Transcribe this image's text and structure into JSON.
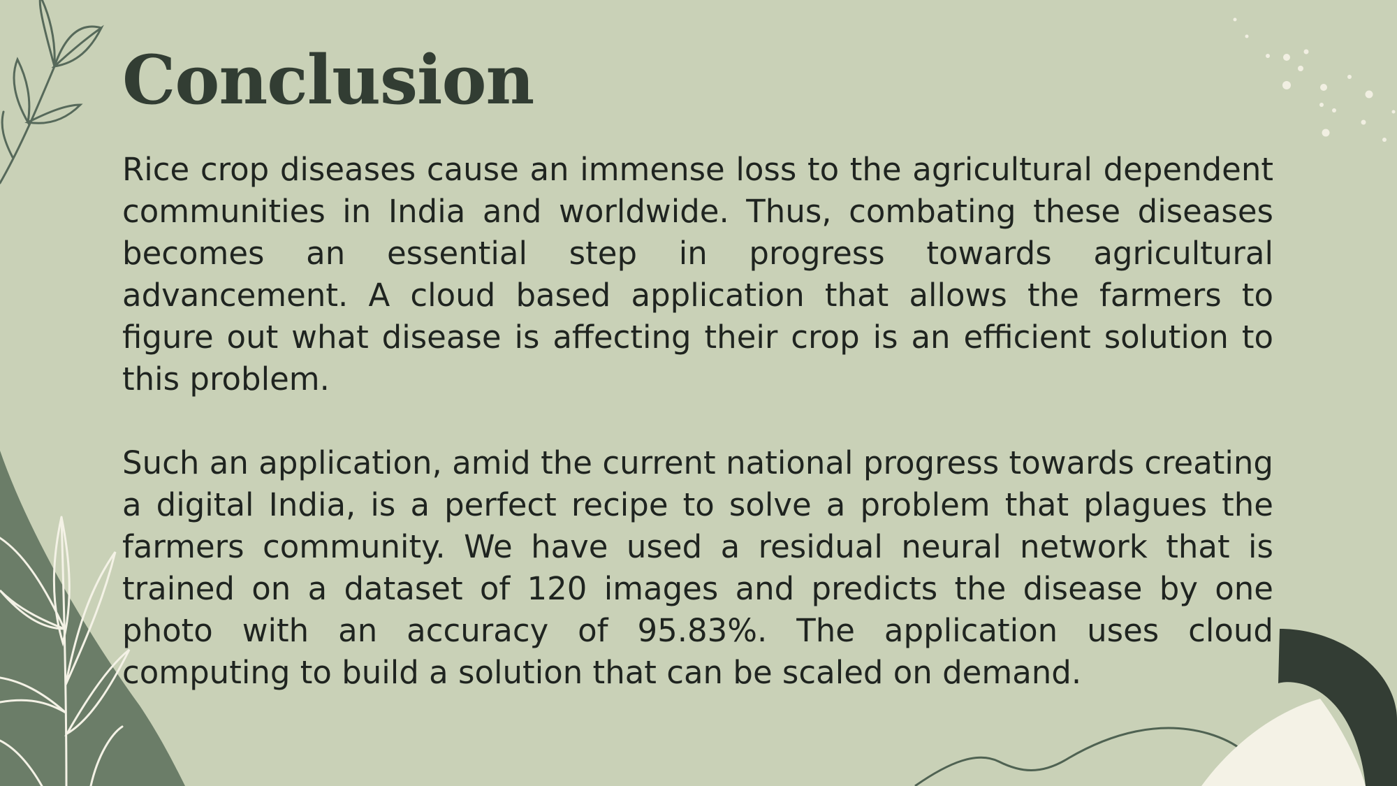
{
  "slide": {
    "title": "Conclusion",
    "paragraphs": [
      "Rice crop diseases cause an immense loss to the agricultural dependent communities in India and worldwide. Thus, combating these diseases becomes an essential step in progress towards agricultural advancement. A cloud based application that allows the farmers to figure out what disease is affecting their crop is an efficient solution to this problem.",
      "Such an application, amid the current national progress towards creating a digital India, is a perfect recipe to solve a problem that plagues the farmers community. We have used a residual neural network that is trained on a dataset of 120 images and predicts the disease by one photo with an accuracy of 95.83%. The application uses cloud computing to build a solution that can be scaled on demand."
    ]
  },
  "colors": {
    "background": "#c9d1b7",
    "title": "#323d33",
    "text": "#1f2420",
    "sage_shape": "#6b7d68",
    "dark_shape": "#333d34",
    "cream_shape": "#f4f2e6",
    "line_art": "#4f6252",
    "dots": "#f4f2e6"
  },
  "decorations": [
    "leaf-branch-top-left",
    "dots-top-right",
    "sage-blob-bottom-left",
    "white-leaves-bottom-left",
    "wavy-line-bottom",
    "dark-arc-bottom-right",
    "cream-arc-bottom-right"
  ]
}
